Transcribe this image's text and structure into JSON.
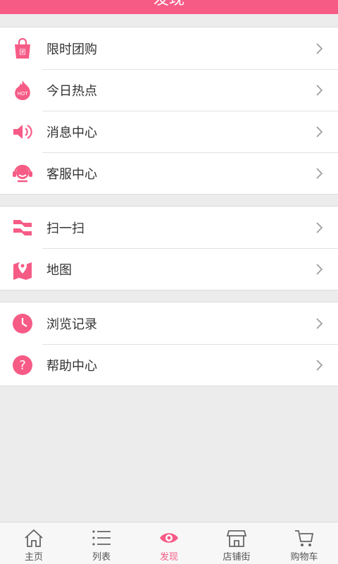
{
  "header": {
    "title": "发现"
  },
  "groups": [
    {
      "items": [
        {
          "label": "限时团购",
          "icon": "shopping-bag-icon"
        },
        {
          "label": "今日热点",
          "icon": "hot-flame-icon"
        },
        {
          "label": "消息中心",
          "icon": "speaker-icon"
        },
        {
          "label": "客服中心",
          "icon": "headset-icon"
        }
      ]
    },
    {
      "items": [
        {
          "label": "扫一扫",
          "icon": "scan-icon"
        },
        {
          "label": "地图",
          "icon": "map-pin-icon"
        }
      ]
    },
    {
      "items": [
        {
          "label": "浏览记录",
          "icon": "clock-icon"
        },
        {
          "label": "帮助中心",
          "icon": "question-icon"
        }
      ]
    }
  ],
  "tabbar": {
    "tabs": [
      {
        "label": "主页",
        "icon": "home-icon"
      },
      {
        "label": "列表",
        "icon": "list-icon"
      },
      {
        "label": "发现",
        "icon": "eye-icon",
        "active": true
      },
      {
        "label": "店铺街",
        "icon": "store-icon"
      },
      {
        "label": "购物车",
        "icon": "cart-icon"
      }
    ]
  },
  "colors": {
    "accent": "#f65b86",
    "background": "#ececec",
    "divider": "#e2e2e2"
  }
}
